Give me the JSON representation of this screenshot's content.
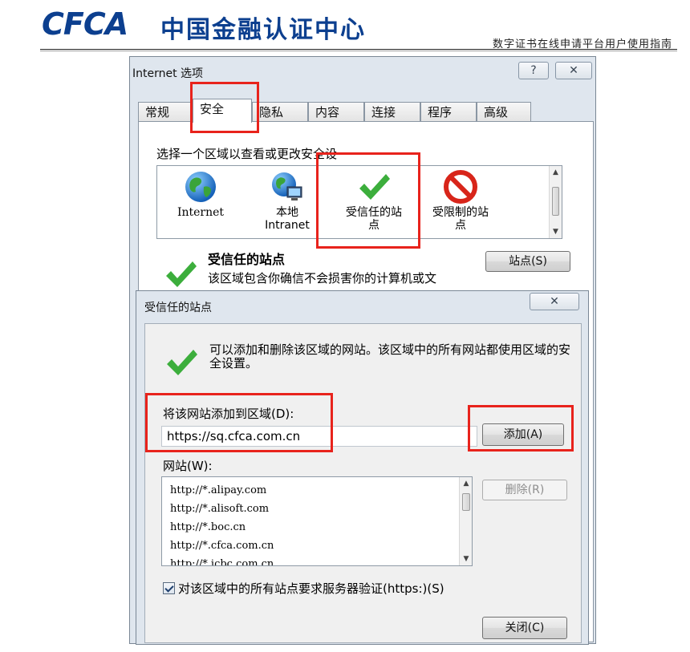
{
  "document": {
    "logo_latin": "CFCA",
    "logo_cn": "中国金融认证中心",
    "subtitle": "数字证书在线申请平台用户使用指南"
  },
  "internet_options": {
    "title": "Internet 选项",
    "caption_buttons": {
      "help": "?",
      "close": "✕"
    },
    "tabs": [
      {
        "label": "常规",
        "active": false
      },
      {
        "label": "安全",
        "active": true
      },
      {
        "label": "隐私",
        "active": false
      },
      {
        "label": "内容",
        "active": false
      },
      {
        "label": "连接",
        "active": false
      },
      {
        "label": "程序",
        "active": false
      },
      {
        "label": "高级",
        "active": false
      }
    ],
    "zone_prompt": "选择一个区域以查看或更改安全设",
    "zones": [
      {
        "label": "Internet",
        "icon": "globe-icon"
      },
      {
        "label": "本地\nIntranet",
        "icon": "intranet-globe-icon"
      },
      {
        "label": "受信任的站\n点",
        "icon": "green-check-icon",
        "selected": true
      },
      {
        "label": "受限制的站\n点",
        "icon": "no-entry-icon"
      }
    ],
    "trusted_heading": "受信任的站点",
    "trusted_description": "该区域包含你确信不会损害你的计算机或文",
    "sites_button": "站点(S)"
  },
  "trusted_sites_dialog": {
    "title": "受信任的站点",
    "close_button": "✕",
    "info_text": "可以添加和删除该区域的网站。该区域中的所有网站都使用区域的安全设置。",
    "add_label": "将该网站添加到区域(D):",
    "url_value": "https://sq.cfca.com.cn",
    "add_button": "添加(A)",
    "websites_label": "网站(W):",
    "websites": [
      "http://*.alipay.com",
      "http://*.alisoft.com",
      "http://*.boc.cn",
      "http://*.cfca.com.cn",
      "http://*.icbc.com.cn"
    ],
    "remove_button": "删除(R)",
    "https_checkbox_label": "对该区域中的所有站点要求服务器验证(https:)(S)",
    "https_checkbox_checked": true,
    "close_label": "关闭(C)"
  },
  "colors": {
    "logo_blue": "#0c3f8f",
    "highlight_red": "#e8231c",
    "check_green": "#3cae3c"
  }
}
